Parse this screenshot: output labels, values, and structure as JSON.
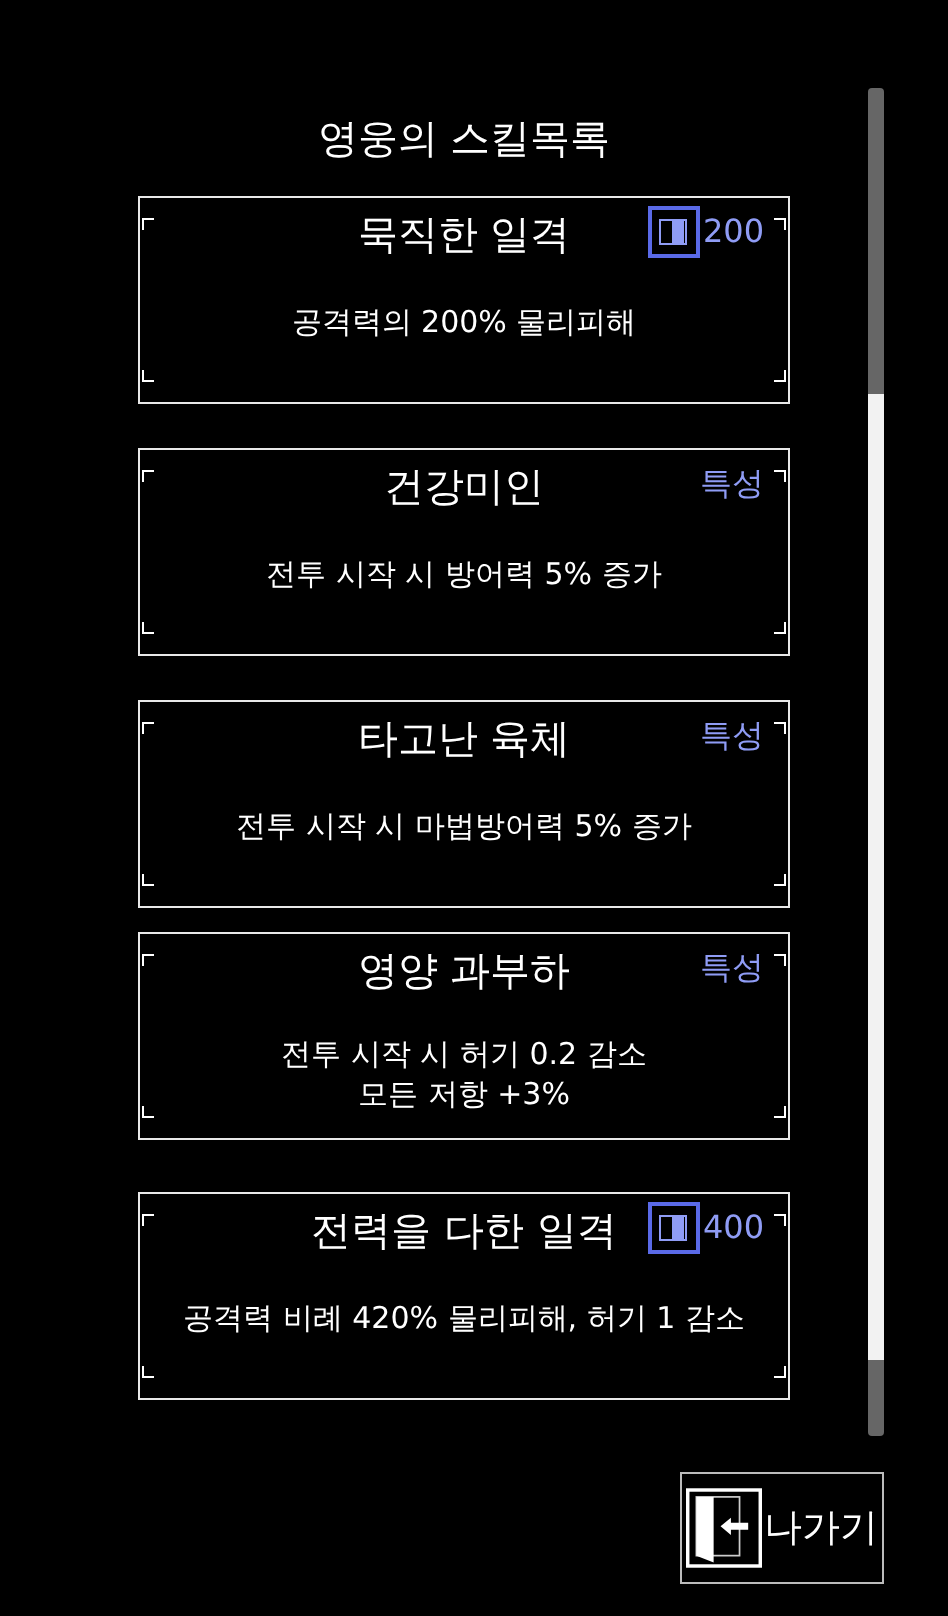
{
  "title": "영웅의 스킬목록",
  "skills": [
    {
      "kind": "skill",
      "name": "묵직한 일격",
      "tag": "200",
      "description": [
        "공격력의 200% 물리피해"
      ]
    },
    {
      "kind": "trait",
      "name": "건강미인",
      "tag": "특성",
      "description": [
        "전투 시작 시 방어력 5% 증가"
      ]
    },
    {
      "kind": "trait",
      "name": "타고난 육체",
      "tag": "특성",
      "description": [
        "전투 시작 시 마법방어력 5% 증가"
      ]
    },
    {
      "kind": "trait",
      "name": "영양 과부하",
      "tag": "특성",
      "description": [
        "전투 시작 시 허기 0.2 감소",
        "모든 저항 +3%"
      ]
    },
    {
      "kind": "skill",
      "name": "전력을 다한 일격",
      "tag": "400",
      "description": [
        "공격력 비례 420% 물리피해, 허기 1 감소"
      ]
    }
  ],
  "exit_button": {
    "label": "나가기"
  }
}
